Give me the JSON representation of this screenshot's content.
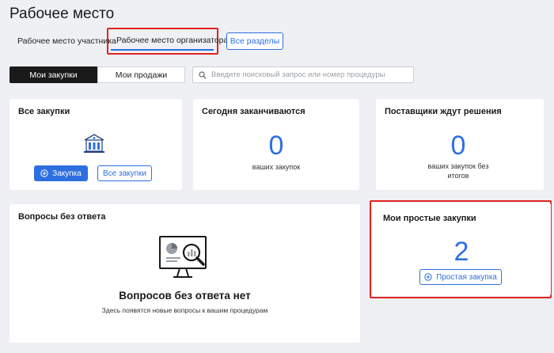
{
  "page": {
    "title": "Рабочее место"
  },
  "tabs": {
    "participant": "Рабочее место участника",
    "organizer": "Рабочее место организатора",
    "all_sections": "Все разделы"
  },
  "segments": {
    "purchases": "Мои закупки",
    "sales": "Мои продажи"
  },
  "search": {
    "placeholder": "Введите поисковый запрос или номер процедуры",
    "value": ""
  },
  "cards": {
    "all_purchases": {
      "title": "Все закупки",
      "primary_button": "Закупка",
      "secondary_button": "Все закупки"
    },
    "ending_today": {
      "title": "Сегодня заканчиваются",
      "count": "0",
      "caption": "ваших закупок"
    },
    "suppliers_waiting": {
      "title": "Поставщики ждут решения",
      "count": "0",
      "caption_line1": "ваших закупок без",
      "caption_line2": "итогов"
    },
    "unanswered_questions": {
      "title": "Вопросы без ответа",
      "empty_title": "Вопросов без ответа нет",
      "empty_subtitle": "Здесь появятся новые вопросы к вашим процедурам"
    },
    "simple_purchases": {
      "title": "Мои простые закупки",
      "count": "2",
      "button": "Простая закупка"
    }
  },
  "icons": {
    "building": "building-icon",
    "search": "search-icon",
    "plus_circle": "plus-circle-icon",
    "monitor_search": "monitor-analytics-search-icon"
  },
  "colors": {
    "accent": "#2d6fe0",
    "highlight_box": "#e02424",
    "background": "#eef0f3",
    "dark_segment": "#1a1a1a"
  }
}
